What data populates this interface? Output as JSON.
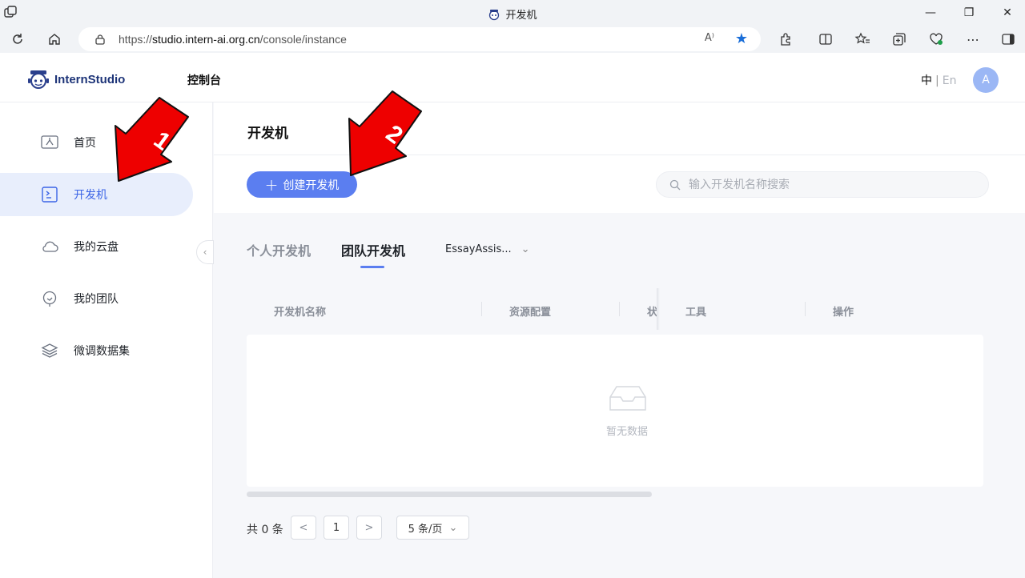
{
  "browser": {
    "tab_title": "开发机",
    "url_prefix": "https://",
    "url_domain": "studio.intern-ai.org.cn",
    "url_path": "/console/instance",
    "read_aloud": "A⁾"
  },
  "header": {
    "brand": "InternStudio",
    "console_label": "控制台",
    "lang_zh": "中",
    "lang_sep": "|",
    "lang_en": "En",
    "avatar_letter": "A"
  },
  "sidebar": {
    "items": [
      {
        "label": "首页",
        "icon": "home-icon"
      },
      {
        "label": "开发机",
        "icon": "terminal-icon",
        "active": true
      },
      {
        "label": "我的云盘",
        "icon": "cloud-icon"
      },
      {
        "label": "我的团队",
        "icon": "team-icon"
      },
      {
        "label": "微调数据集",
        "icon": "dataset-icon"
      }
    ]
  },
  "main": {
    "title": "开发机",
    "create_button": "创建开发机",
    "search_placeholder": "输入开发机名称搜索",
    "tabs": [
      {
        "label": "个人开发机",
        "active": false
      },
      {
        "label": "团队开发机",
        "active": true
      }
    ],
    "team_select": "EssayAssis...",
    "columns": [
      "开发机名称",
      "资源配置",
      "状",
      "工具",
      "操作"
    ],
    "empty_text": "暂无数据",
    "pagination": {
      "total": "共 0 条",
      "prev": "<",
      "page": "1",
      "next": ">",
      "page_size": "5 条/页"
    }
  },
  "annotations": {
    "arrow1_label": "1",
    "arrow2_label": "2",
    "color": "#ee0000"
  }
}
